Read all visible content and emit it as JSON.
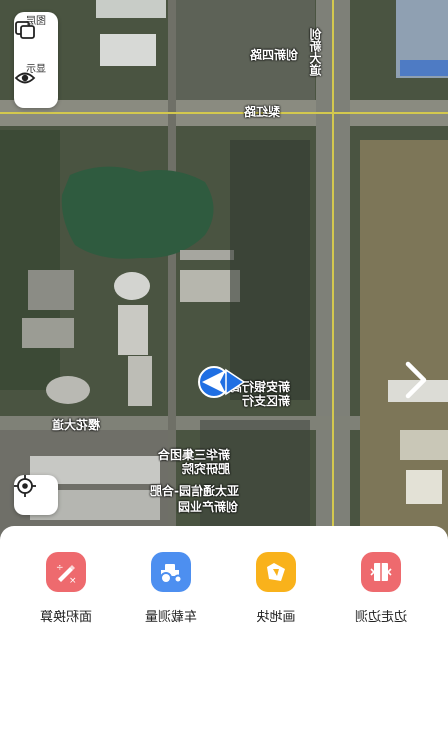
{
  "map": {
    "labels": {
      "road_top": "创新四路",
      "road_vertical": "创新大道",
      "road_east": "梨红路",
      "road_south": "樱花大道",
      "bank": "新安银行高新区支行",
      "company": "新华三集团合肥研究院",
      "building": "亚太通信园-合肥",
      "park": "创新产业园"
    }
  },
  "layer_panel": {
    "layers_label": "图层",
    "display_label": "显示"
  },
  "toolbar": {
    "tools": [
      {
        "label": "面积换算",
        "icon": "calculator-icon",
        "color": "#ee6a6e"
      },
      {
        "label": "车载测量",
        "icon": "tractor-icon",
        "color": "#4d8ff0"
      },
      {
        "label": "画地块",
        "icon": "draw-plot-icon",
        "color": "#f9b21b"
      },
      {
        "label": "边走边测",
        "icon": "walk-measure-icon",
        "color": "#ee6a6e"
      }
    ]
  }
}
